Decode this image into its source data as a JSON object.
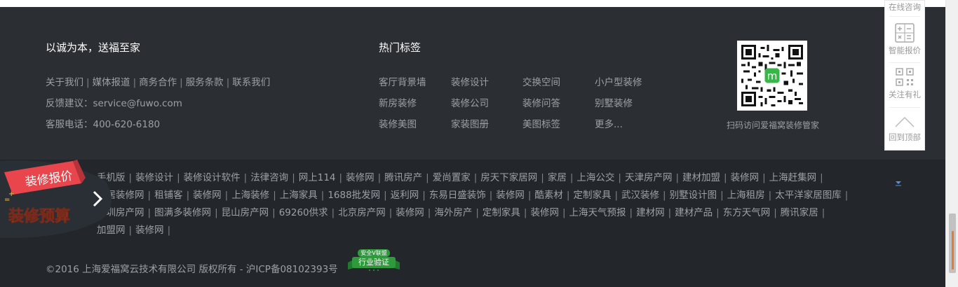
{
  "footer": {
    "slogan": "以诚为本，送福至家",
    "about_links": [
      "关于我们",
      "媒体报道",
      "商务合作",
      "服务条款",
      "联系我们"
    ],
    "feedback": "反馈建议：service@fuwo.com",
    "service_phone": "客服电话：400-620-6180",
    "hot_tags_title": "热门标签",
    "hot_tags": [
      [
        "客厅背景墙",
        "装修设计",
        "交换空间",
        "小户型装修"
      ],
      [
        "新房装修",
        "装修公司",
        "装修问答",
        "别墅装修"
      ],
      [
        "装修美图",
        "家装图册",
        "美图标签",
        "更多..."
      ]
    ],
    "qr_caption": "扫码访问爱福窝装修管家",
    "friend_links": [
      [
        "手机版",
        "装修设计",
        "装修设计软件",
        "法律咨询",
        "网上114",
        "装修网",
        "腾讯房产",
        "爱尚置家",
        "房天下家居网",
        "家居",
        "上海公交",
        "天津房产网",
        "建材加盟",
        "装修网",
        "上海赶集网"
      ],
      [
        "家居装修网",
        "租铺客",
        "装修网",
        "上海装修",
        "上海家具",
        "1688批发网",
        "返利网",
        "东易日盛装饰",
        "装修网",
        "酷素材",
        "定制家具",
        "武汉装修",
        "别墅设计图",
        "上海租房",
        "太平洋家居图库"
      ],
      [
        "深圳房产网",
        "图满多装修网",
        "昆山房产网",
        "69260供求",
        "北京房产网",
        "装修网",
        "海外房产",
        "定制家具",
        "装修网",
        "上海天气预报",
        "建材网",
        "建材产品",
        "东方天气网",
        "腾讯家居"
      ],
      [
        "加盟网",
        "装修网"
      ]
    ],
    "copyright": "©2016 上海爱福窝云技术有限公司 版权所有 - 沪ICP备08102393号",
    "verify_badge": {
      "top": "安全V联盟",
      "main": "行业验证"
    }
  },
  "float_panel": {
    "online": "在线咨询",
    "quote": "智能报价",
    "follow": "关注有礼",
    "top": "回到顶部"
  },
  "promo": {
    "line1": "装修报价",
    "line2": "装修预算"
  },
  "colors": {
    "footer_bg": "#2b2f33",
    "footer_bottom_bg": "#23272b",
    "text_muted": "#9aa0a6",
    "promo_red": "#e8464c",
    "badge_green": "#2e9a3b"
  }
}
